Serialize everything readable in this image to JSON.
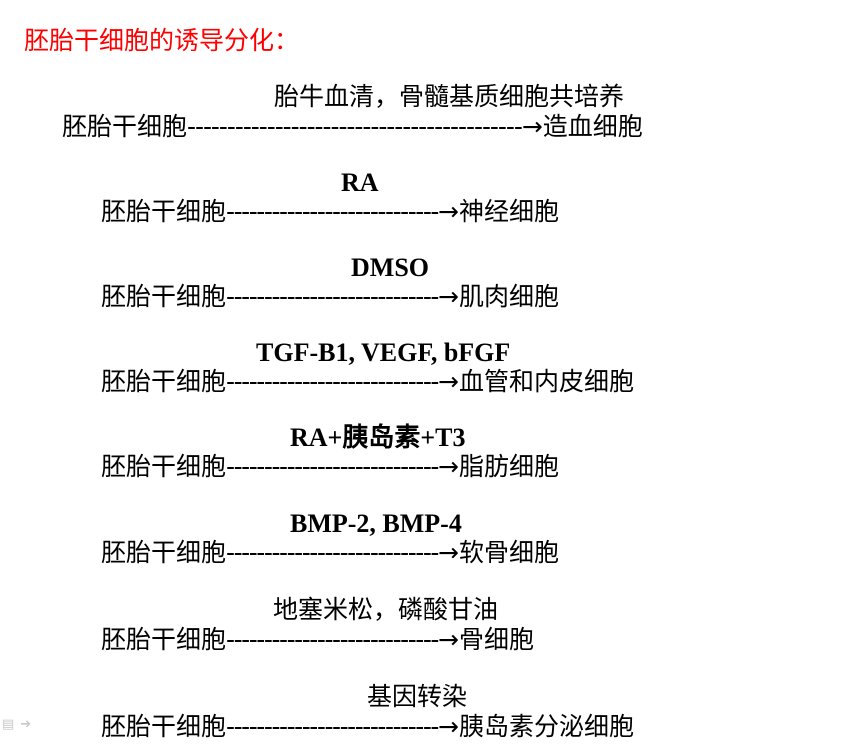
{
  "title": "胚胎干细胞的诱导分化：",
  "colors": {
    "title": "#ff0000",
    "text": "#000000"
  },
  "rows": [
    {
      "label": "胎牛血清，骨髓基质细胞共培养",
      "label_bold": false,
      "source": "胚胎干细胞",
      "dashes": "------------------------------------------",
      "arrow": "→",
      "target": "造血细胞"
    },
    {
      "label": "RA",
      "label_bold": true,
      "source": "胚胎干细胞",
      "dashes": "----------------------------",
      "arrow": "→",
      "target": "神经细胞"
    },
    {
      "label": "DMSO",
      "label_bold": true,
      "source": "胚胎干细胞",
      "dashes": "----------------------------",
      "arrow": "→",
      "target": "肌肉细胞"
    },
    {
      "label": "TGF-B1, VEGF, bFGF",
      "label_bold": true,
      "source": "胚胎干细胞",
      "dashes": "----------------------------",
      "arrow": "→",
      "target": "血管和内皮细胞"
    },
    {
      "label": "RA+胰岛素+T3",
      "label_bold": true,
      "source": "胚胎干细胞",
      "dashes": "----------------------------",
      "arrow": "→",
      "target": "脂肪细胞"
    },
    {
      "label": "BMP-2, BMP-4",
      "label_bold": true,
      "source": "胚胎干细胞",
      "dashes": "----------------------------",
      "arrow": "→",
      "target": "软骨细胞"
    },
    {
      "label": "地塞米松，磷酸甘油",
      "label_bold": false,
      "source": "胚胎干细胞",
      "dashes": "----------------------------",
      "arrow": "→",
      "target": "骨细胞"
    },
    {
      "label": "基因转染",
      "label_bold": false,
      "source": "胚胎干细胞",
      "dashes": "----------------------------",
      "arrow": "→",
      "target": "胰岛素分泌细胞"
    }
  ],
  "nav_icons": [
    "menu-icon",
    "next-arrow-icon"
  ]
}
